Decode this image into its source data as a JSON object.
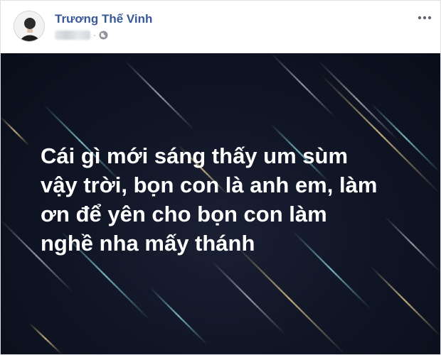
{
  "post": {
    "author_name": "Trương Thế Vinh",
    "privacy_icon": "globe-icon",
    "more_icon": "more-options-icon",
    "status_text": "Cái gì mới sáng thấy um sùm\nvậy trời, bọn con là anh em, làm\nơn để yên cho bọn con làm\nnghề nha mấy thánh",
    "background_color": "#0f1424",
    "text_color": "#ffffff",
    "name_color": "#385898"
  }
}
